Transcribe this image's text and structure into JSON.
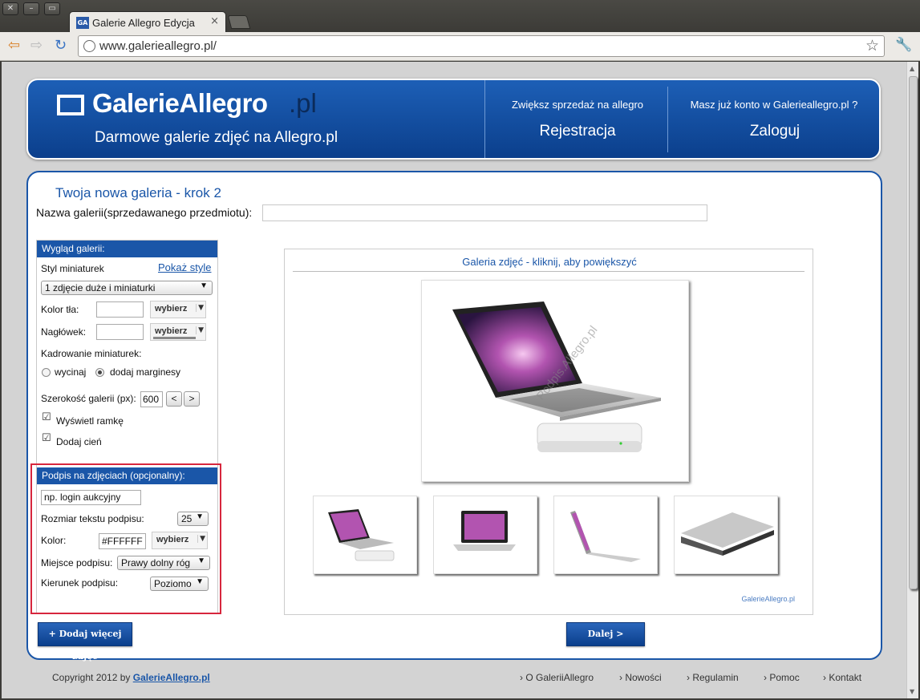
{
  "browser": {
    "tab_title": "Galerie Allegro Edycja",
    "tab_favicon": "GA",
    "url": "www.galerieallegro.pl/"
  },
  "header": {
    "logo_main": "GalerieAllegro",
    "logo_suffix": ".pl",
    "tagline": "Darmowe galerie zdjęć na Allegro.pl",
    "register_hint": "Zwiększ sprzedaż na allegro",
    "register_label": "Rejestracja",
    "login_hint": "Masz już konto w Galerieallegro.pl ?",
    "login_label": "Zaloguj"
  },
  "form": {
    "page_title": "Twoja nowa galeria - krok 2",
    "name_label": "Nazwa galerii(sprzedawanego przedmiotu):",
    "name_value": ""
  },
  "appearance": {
    "heading": "Wygląd galerii:",
    "thumb_style_label": "Styl miniaturek",
    "show_styles_link": "Pokaż style",
    "thumb_style_value": "1 zdjęcie duże i miniaturki",
    "bg_color_label": "Kolor tła:",
    "bg_color_value": "",
    "header_label": "Nagłówek:",
    "header_value": "",
    "picker_label": "wybierz",
    "crop_label": "Kadrowanie miniaturek:",
    "crop_option_cut": "wycinaj",
    "crop_option_margin": "dodaj marginesy",
    "crop_selected": "dodaj marginesy",
    "width_label": "Szerokość galerii (px):",
    "width_value": "600",
    "width_dec": "<",
    "width_inc": ">",
    "show_frame_label": "Wyświetl ramkę",
    "show_frame_checked": true,
    "add_shadow_label": "Dodaj cień",
    "add_shadow_checked": true
  },
  "caption": {
    "heading": "Podpis na zdjęciach (opcjonalny):",
    "text_value": "np. login aukcyjny",
    "size_label": "Rozmiar tekstu podpisu:",
    "size_value": "25",
    "color_label": "Kolor:",
    "color_value": "#FFFFFF",
    "picker_label": "wybierz",
    "place_label": "Miejsce podpisu:",
    "place_value": "Prawy dolny róg",
    "direction_label": "Kierunek podpisu:",
    "direction_value": "Poziomo"
  },
  "preview": {
    "title": "Galeria zdjęć - kliknij, aby powiększyć",
    "watermark": "GalerieAllegro.pl",
    "image_watermark": "Podpis.Allegro.pl"
  },
  "actions": {
    "add_more_label": "+ Dodaj więcej zdjęć",
    "next_label": "Dalej >"
  },
  "footer": {
    "copyright_prefix": "Copyright 2012 by ",
    "copyright_link": "GalerieAllegro.pl",
    "links": [
      "O GaleriiAllegro",
      "Nowości",
      "Regulamin",
      "Pomoc",
      "Kontakt"
    ]
  },
  "colors": {
    "brand_blue": "#1a56a8",
    "highlight_red": "#d7263d"
  }
}
